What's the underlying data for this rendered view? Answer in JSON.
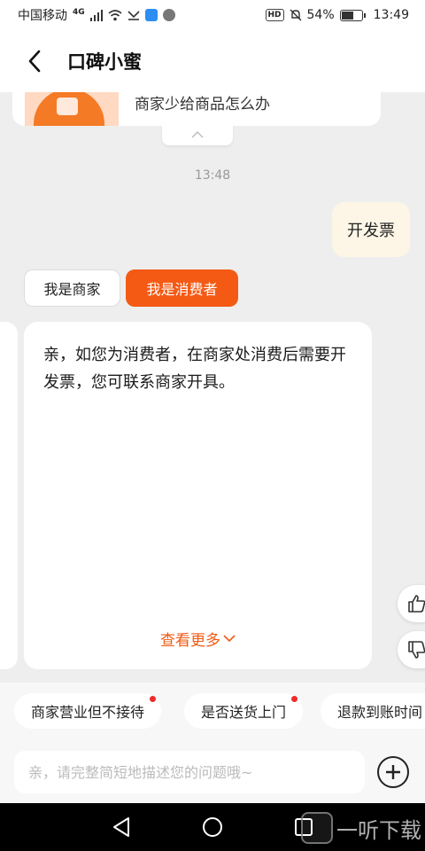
{
  "status_bar": {
    "carrier": "中国移动",
    "network": "4G",
    "battery_percent": "54%",
    "battery_level": 0.54,
    "time": "13:49"
  },
  "header": {
    "title": "口碑小蜜"
  },
  "chat": {
    "previous_card_text": "商家少给商品怎么办",
    "timestamp": "13:48",
    "user_message": "开发票",
    "role_options": [
      "我是商家",
      "我是消费者"
    ],
    "selected_role": "我是消费者",
    "answer_text": "亲，如您为消费者，在商家处消费后需要开发票，您可联系商家开具。",
    "see_more_label": "查看更多"
  },
  "quick_questions": [
    {
      "label": "商家营业但不接待",
      "has_dot": true
    },
    {
      "label": "是否送货上门",
      "has_dot": true
    },
    {
      "label": "退款到账时间",
      "has_dot": false
    }
  ],
  "input": {
    "placeholder": "亲，请完整简短地描述您的问题哦~"
  },
  "watermark": {
    "text": "一听下载"
  },
  "colors": {
    "accent": "#f55a15",
    "user_bubble": "#fdf6e7",
    "background": "#eeeeee",
    "notification_dot": "#ee2b2b"
  }
}
